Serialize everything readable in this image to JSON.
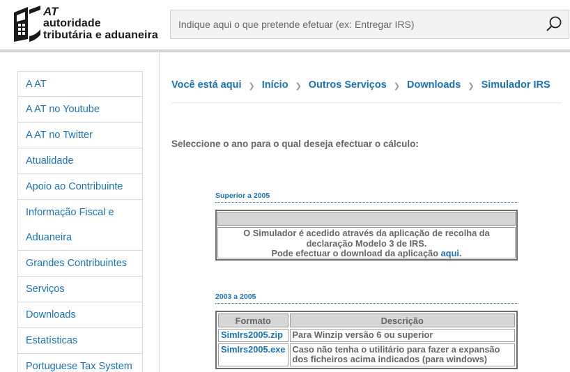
{
  "header": {
    "logo": {
      "at": "AT",
      "line1": "autoridade",
      "line2": "tributária e aduaneira"
    },
    "search": {
      "placeholder": "Indique aqui o que pretende efetuar (ex: Entregar IRS)"
    }
  },
  "sidebar": {
    "items": [
      {
        "label": "A AT"
      },
      {
        "label": "A AT no Youtube"
      },
      {
        "label": "A AT no Twitter"
      },
      {
        "label": "Atualidade"
      },
      {
        "label": "Apoio ao Contribuinte"
      },
      {
        "label": "Informação Fiscal e Aduaneira"
      },
      {
        "label": "Grandes Contribuintes"
      },
      {
        "label": "Serviços"
      },
      {
        "label": "Downloads"
      },
      {
        "label": "Estatísticas"
      },
      {
        "label": "Portuguese Tax System"
      }
    ]
  },
  "breadcrumb": {
    "lead": "Você está aqui",
    "items": [
      "Início",
      "Outros Serviços",
      "Downloads",
      "Simulador IRS"
    ]
  },
  "intro": "Seleccione o ano para o qual deseja efectuar o cálculo:",
  "sections": {
    "superior": {
      "title": "Superior a 2005",
      "line1": "O Simulador é acedido através da aplicação de recolha da",
      "line2": "declaração Modelo 3 de IRS.",
      "line3_prefix": "Pode efectuar o download da aplicação ",
      "link": "aqui",
      "line3_suffix": "."
    },
    "range": {
      "title": "2003 a 2005",
      "headers": [
        "Formato",
        "Descrição"
      ],
      "rows": [
        {
          "file": "SimIrs2005.zip",
          "desc": "Para Winzip versão 6 ou superior"
        },
        {
          "file": "SimIrs2005.exe",
          "desc": "Caso não tenha o utilitário para fazer a expansão dos ficheiros acima indicados (para windows)"
        }
      ]
    }
  },
  "colors": {
    "link": "#1a73b9",
    "text": "#666666",
    "table_header": "#d6d6d6"
  }
}
